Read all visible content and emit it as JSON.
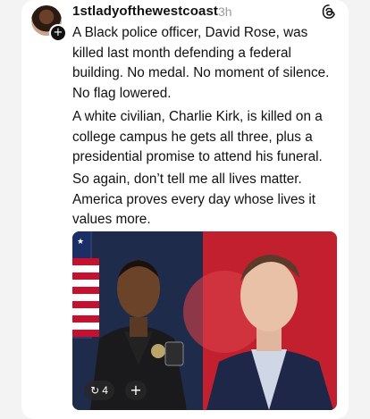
{
  "post": {
    "username": "1stladyofthewestcoast",
    "time": "3h",
    "paragraphs": [
      "A Black police officer, David Rose, was killed last month defending a federal building. No medal. No moment of silence. No flag lowered.",
      "A white civilian, Charlie Kirk, is killed on a college campus he gets all three, plus a presidential promise to attend his funeral.",
      "So again, don’t tell me all lives matter. America proves every day whose lives it values more."
    ],
    "media": {
      "repost_count": "4",
      "add_symbol": "+",
      "repost_icon": "repost-icon"
    }
  },
  "icons": {
    "app": "threads-logo-icon",
    "avatar_badge": "plus-icon"
  },
  "colors": {
    "background": "#f3f3f3",
    "card": "#ffffff",
    "text": "#111111",
    "muted": "#9a9a9a",
    "photo_left_bg": "#1f2b4a",
    "photo_right_bg": "#c2202e"
  }
}
